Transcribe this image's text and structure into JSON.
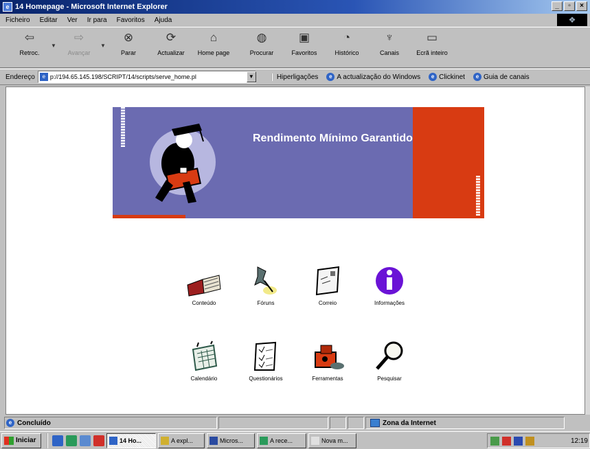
{
  "window": {
    "title": "14 Homepage - Microsoft Internet Explorer"
  },
  "menu": [
    "Ficheiro",
    "Editar",
    "Ver",
    "Ir para",
    "Favoritos",
    "Ajuda"
  ],
  "toolbar": {
    "back": "Retroc.",
    "forward": "Avançar",
    "stop": "Parar",
    "refresh": "Actualizar",
    "home": "Home page",
    "search": "Procurar",
    "favorites": "Favoritos",
    "history": "Histórico",
    "channels": "Canais",
    "fullscreen": "Ecrã inteiro"
  },
  "address": {
    "label": "Endereço",
    "value": "p://194.65.145.198/SCRIPT/14/scripts/serve_home.pl",
    "links_label": "Hiperligações",
    "links": [
      "A actualização do Windows",
      "Clickinet",
      "Guia de canais"
    ]
  },
  "banner": {
    "title": "Rendimento Mínimo Garantido"
  },
  "nav": {
    "conteudo": "Conteúdo",
    "foruns": "Fóruns",
    "correio": "Correio",
    "informacoes": "Informações",
    "calendario": "Calendário",
    "questionarios": "Questionários",
    "ferramentas": "Ferramentas",
    "pesquisar": "Pesquisar"
  },
  "status": {
    "text": "Concluído",
    "zone": "Zona da Internet"
  },
  "taskbar": {
    "start": "Iniciar",
    "tasks": [
      "14 Ho...",
      "A expl...",
      "Micros...",
      "A rece...",
      "Nova m..."
    ],
    "clock": "12:19"
  }
}
